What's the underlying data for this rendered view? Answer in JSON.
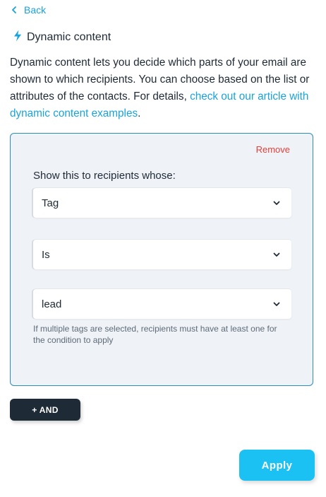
{
  "nav": {
    "back_label": "Back",
    "back_icon": "chevron-left-icon"
  },
  "section": {
    "title": "Dynamic content",
    "icon": "lightning-bolt-icon",
    "description_text": "Dynamic content lets you decide which parts of your email are shown to which recipients. You can choose based on the list or attributes of the contacts. For details, ",
    "description_link": "check out our article with dynamic content examples",
    "description_end": "."
  },
  "condition": {
    "remove_label": "Remove",
    "label": "Show this to recipients whose:",
    "attribute_select": {
      "value": "Tag"
    },
    "operator_select": {
      "value": "Is"
    },
    "value_select": {
      "value": "lead"
    },
    "hint": "If multiple tags are selected, recipients must have at least one for the condition to apply"
  },
  "actions": {
    "and_label": "+ AND",
    "apply_label": "Apply"
  },
  "colors": {
    "accent": "#19a3db",
    "danger": "#e0413b",
    "dark_button": "#1f2a37",
    "primary_button": "#1cc1f4",
    "card_background": "#eff2f6",
    "card_border": "#2e8cb8"
  }
}
